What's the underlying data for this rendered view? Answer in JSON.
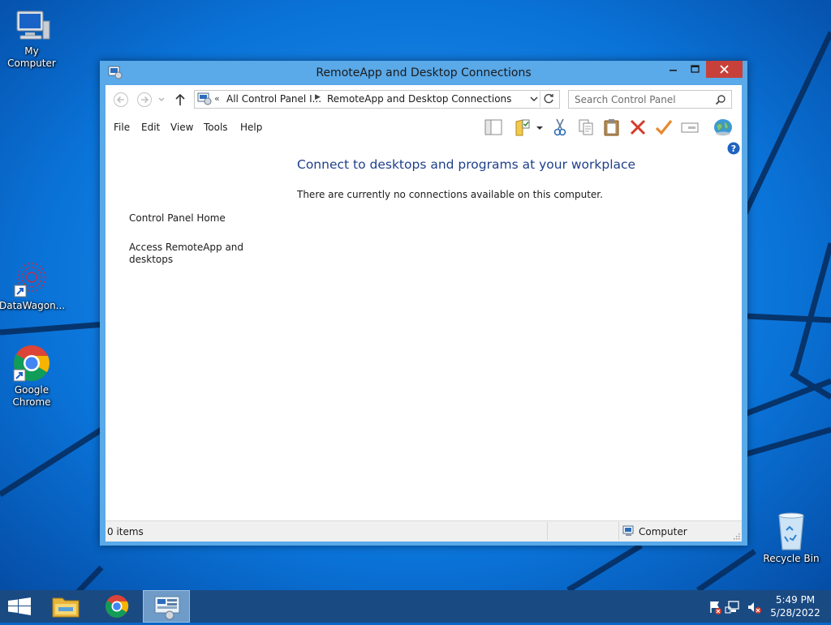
{
  "desktop": {
    "icons": [
      {
        "label": "My Computer",
        "icon": "computer-icon"
      },
      {
        "label": "DataWagon...",
        "icon": "datawagon-icon"
      },
      {
        "label": "Google Chrome",
        "icon": "chrome-icon"
      },
      {
        "label": "Recycle Bin",
        "icon": "recycle-bin-icon"
      }
    ]
  },
  "window": {
    "title": "RemoteApp and Desktop Connections",
    "address": {
      "overflow": "«",
      "segment1": "All Control Panel I...",
      "segment2": "RemoteApp and Desktop Connections"
    },
    "search_placeholder": "Search Control Panel",
    "menu": [
      "File",
      "Edit",
      "View",
      "Tools",
      "Help"
    ],
    "toolbar": [
      "layout-icon",
      "properties-folder-icon",
      "cut-icon",
      "copy-icon",
      "paste-icon",
      "delete-icon",
      "check-icon",
      "rename-icon",
      "globe-icon"
    ],
    "sidebar": {
      "home": "Control Panel Home",
      "access": "Access RemoteApp and desktops"
    },
    "main": {
      "heading": "Connect to desktops and programs at your workplace",
      "text": "There are currently no connections available on this computer."
    },
    "status": {
      "items": "0 items",
      "location": "Computer"
    }
  },
  "taskbar": {
    "items": [
      "start-icon",
      "file-explorer-icon",
      "chrome-icon",
      "control-panel-icon"
    ],
    "tray": [
      "action-center-icon",
      "network-icon",
      "volume-muted-icon"
    ],
    "time": "5:49 PM",
    "date": "5/28/2022"
  },
  "colors": {
    "desktop": "#0a66c8",
    "window_frame": "#5aa9e8",
    "close_button": "#c7413a",
    "heading": "#1e3f8b",
    "taskbar": "#1a4a82"
  }
}
